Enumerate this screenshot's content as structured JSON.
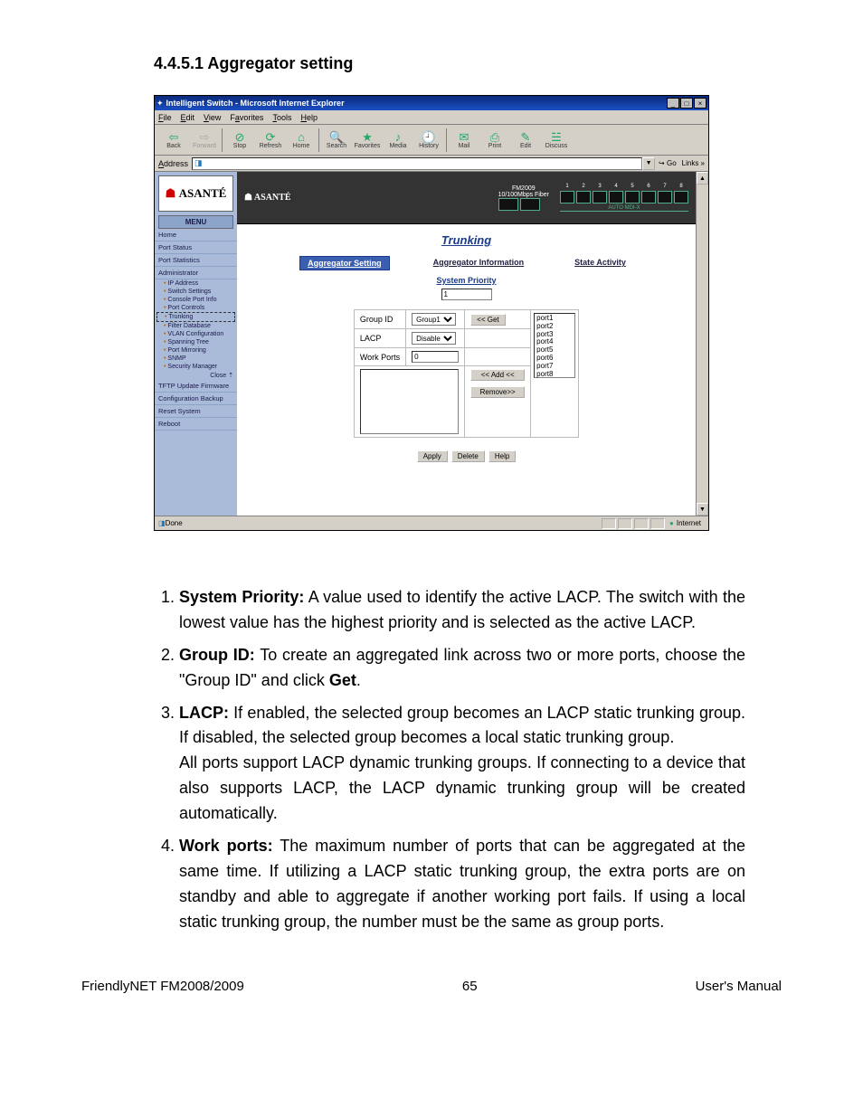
{
  "heading": "4.4.5.1 Aggregator setting",
  "browser": {
    "title": "Intelligent Switch - Microsoft Internet Explorer",
    "menus": {
      "file": "File",
      "edit": "Edit",
      "view": "View",
      "favorites": "Favorites",
      "tools": "Tools",
      "help": "Help"
    },
    "toolbar": {
      "back": "Back",
      "forward": "Forward",
      "stop": "Stop",
      "refresh": "Refresh",
      "home": "Home",
      "search": "Search",
      "favorites": "Favorites",
      "media": "Media",
      "history": "History",
      "mail": "Mail",
      "print": "Print",
      "edit": "Edit",
      "discuss": "Discuss"
    },
    "address_label": "Address",
    "go": "Go",
    "links": "Links",
    "status_done": "Done",
    "status_zone": "Internet"
  },
  "switch_banner": {
    "brand": "ASANTÉ",
    "model": "FM2009",
    "port_label": "10/100Mbps Fiber",
    "auto_mdix": "AUTO MDI-X",
    "port_numbers": [
      "1",
      "2",
      "3",
      "4",
      "5",
      "6",
      "7",
      "8"
    ]
  },
  "sidebar": {
    "logo": "ASANTÉ",
    "menu_header": "MENU",
    "items": {
      "home": "Home",
      "port_status": "Port Status",
      "port_statistics": "Port Statistics",
      "administrator": "Administrator"
    },
    "subs": {
      "ip": "IP Address",
      "switch": "Switch Settings",
      "console": "Console Port Info",
      "portcontrols": "Port Controls",
      "trunking": "Trunking",
      "filter": "Filter Database",
      "vlan": "VLAN Configuration",
      "spanning": "Spanning Tree",
      "mirroring": "Port Mirroring",
      "snmp": "SNMP",
      "security": "Security Manager"
    },
    "close": "Close",
    "tftp": "TFTP Update Firmware",
    "backup": "Configuration Backup",
    "reset": "Reset System",
    "reboot": "Reboot"
  },
  "trunking": {
    "title": "Trunking",
    "tabs": {
      "setting": "Aggregator Setting",
      "info": "Aggregator Information",
      "state": "State Activity"
    },
    "system_priority_label": "System Priority",
    "system_priority_value": "1",
    "group_id_label": "Group ID",
    "group_id_value": "Group1",
    "get": "<< Get",
    "lacp_label": "LACP",
    "lacp_value": "Disable",
    "work_ports_label": "Work Ports",
    "work_ports_value": "0",
    "add": "<< Add <<",
    "remove": "Remove>>",
    "ports": [
      "port1",
      "port2",
      "port3",
      "port4",
      "port5",
      "port6",
      "port7",
      "port8"
    ],
    "apply": "Apply",
    "delete": "Delete",
    "help": "Help"
  },
  "list": [
    {
      "term": "System Priority:",
      "body_a": " A value used to identify the active LACP. The switch with the lowest value has the highest priority and is selected as the active LACP."
    },
    {
      "term": "Group ID:",
      "body_a": " To create an aggregated link across two or more ports, choose the \"Group ID\" and click ",
      "bold2": "Get",
      "body_b": "."
    },
    {
      "term": "LACP:",
      "body_a": " If enabled, the selected group becomes an LACP static trunking group. If disabled, the selected group becomes a local static trunking group.",
      "body_b": "All ports support LACP dynamic trunking groups. If connecting to a device that also supports LACP, the LACP dynamic trunking group will be created automatically."
    },
    {
      "term": "Work ports:",
      "body_a": " The maximum number of ports that can be aggregated at the same time. If utilizing a LACP static trunking group, the extra ports are on standby and able to aggregate if another working port fails. If using a local static trunking group, the number must be the same as group ports."
    }
  ],
  "footer": {
    "left": "FriendlyNET FM2008/2009",
    "center": "65",
    "right": "User's Manual"
  }
}
